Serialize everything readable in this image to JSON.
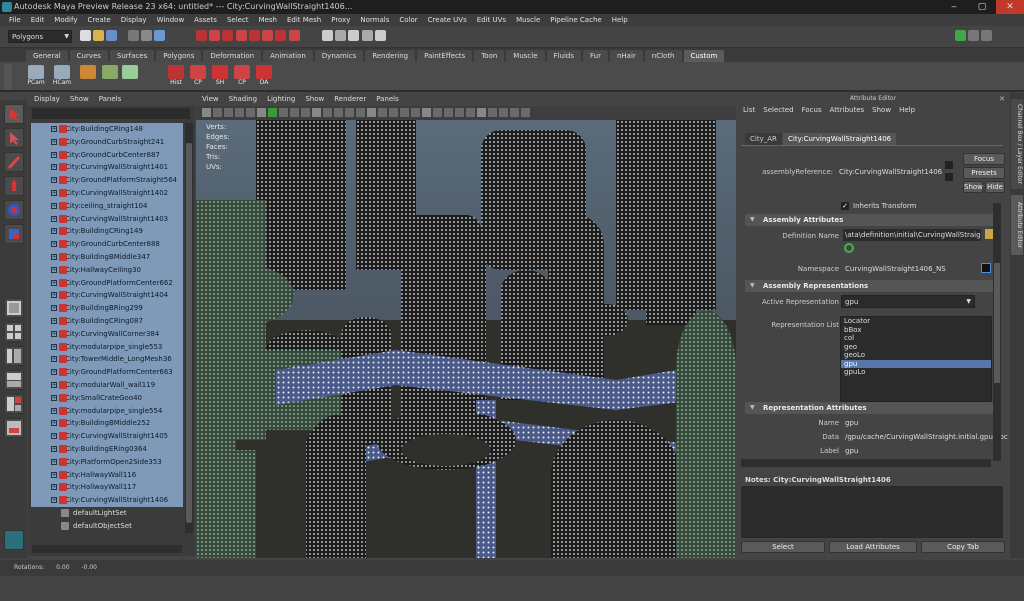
{
  "window": {
    "title": "Autodesk Maya Preview Release 23 x64: untitled*  ---  City:CurvingWallStraight1406..."
  },
  "menubar": [
    "File",
    "Edit",
    "Modify",
    "Create",
    "Display",
    "Window",
    "Assets",
    "Select",
    "Mesh",
    "Edit Mesh",
    "Proxy",
    "Normals",
    "Color",
    "Create UVs",
    "Edit UVs",
    "Muscle",
    "Pipeline Cache",
    "Help"
  ],
  "status": {
    "mode": "Polygons"
  },
  "shelf_tabs": [
    "General",
    "Curves",
    "Surfaces",
    "Polygons",
    "Deformation",
    "Animation",
    "Dynamics",
    "Rendering",
    "PaintEffects",
    "Toon",
    "Muscle",
    "Fluids",
    "Fur",
    "nHair",
    "nCloth",
    "Custom"
  ],
  "shelf_active": "Custom",
  "shelf_buttons": [
    "PCam",
    "HCam",
    "",
    "",
    "",
    "Hist",
    "CP",
    "SH",
    "CP",
    "DA"
  ],
  "outliner": {
    "menu": [
      "Display",
      "Show",
      "Panels"
    ],
    "items": [
      "City:BuildingCRing148",
      "City:GroundCurbStraight241",
      "City:GroundCurbCenter887",
      "City:CurvingWallStraight1401",
      "City:GroundPlatformStraight564",
      "City:CurvingWallStraight1402",
      "City:ceiling_straight104",
      "City:CurvingWallStraight1403",
      "City:BuildingCRing149",
      "City:GroundCurbCenter888",
      "City:BuildingBMiddle347",
      "City:HallwayCeiling30",
      "City:GroundPlatformCenter662",
      "City:CurvingWallStraight1404",
      "City:BuildingBRing299",
      "City:BuildingCRing087",
      "City:CurvingWallCorner384",
      "City:modularpipe_single553",
      "City:TowerMiddle_LongMesh36",
      "City:GroundPlatformCenter663",
      "City:modularWall_wall119",
      "City:SmallCrateGoo40",
      "City:modularpipe_single554",
      "City:BuildingBMiddle252",
      "City:CurvingWallStraight1405",
      "City:BuildingERing0364",
      "City:PlatformOpen2Side353",
      "City:HallwayWall116",
      "City:HallwayWall117",
      "City:CurvingWallStraight1406"
    ],
    "sets": [
      "defaultLightSet",
      "defaultObjectSet"
    ]
  },
  "viewport": {
    "menu": [
      "View",
      "Shading",
      "Lighting",
      "Show",
      "Renderer",
      "Panels"
    ],
    "hud": [
      "Verts:",
      "Edges:",
      "Faces:",
      "Tris:",
      "UVs:"
    ]
  },
  "attribute_editor": {
    "panel_title": "Attribute Editor",
    "menu": [
      "List",
      "Selected",
      "Focus",
      "Attributes",
      "Show",
      "Help"
    ],
    "tabs": [
      "City_AR",
      "City:CurvingWallStraight1406"
    ],
    "assembly_ref_label": "assemblyReference:",
    "assembly_ref_value": "City:CurvingWallStraight1406",
    "buttons": {
      "focus": "Focus",
      "presets": "Presets",
      "show": "Show",
      "hide": "Hide"
    },
    "inherits_transform": "Inherits Transform",
    "sections": {
      "assembly": "Assembly Attributes",
      "representations": "Assembly Representations",
      "rep_attrs": "Representation Attributes"
    },
    "definition_label": "Definition Name",
    "definition_value": "\\ata\\definition\\initial\\CurvingWallStraight.ma",
    "namespace_label": "Namespace",
    "namespace_value": "CurvingWallStraight1406_NS",
    "active_rep_label": "Active Representation",
    "active_rep_value": "gpu",
    "rep_list_label": "Representation List",
    "rep_list": [
      "Locator",
      "bBox",
      "col",
      "geo",
      "geoLo",
      "gpu",
      "gpuLo"
    ],
    "rep_list_selected": "gpu",
    "name_label": "Name",
    "name_value": "gpu",
    "data_label": "Data",
    "data_value": "/gpu/cache/CurvingWallStraight.initial.gpu.abc",
    "label_label": "Label",
    "label_value": "gpu",
    "notes": "Notes: City:CurvingWallStraight1406",
    "bottom_buttons": [
      "Select",
      "Load Attributes",
      "Copy Tab"
    ]
  },
  "side_tabs": [
    "Channel Box / Layer Editor",
    "Attribute Editor"
  ],
  "helpline": {
    "label": "Rotations:",
    "value1": "0.00",
    "value2": "-0.00"
  }
}
